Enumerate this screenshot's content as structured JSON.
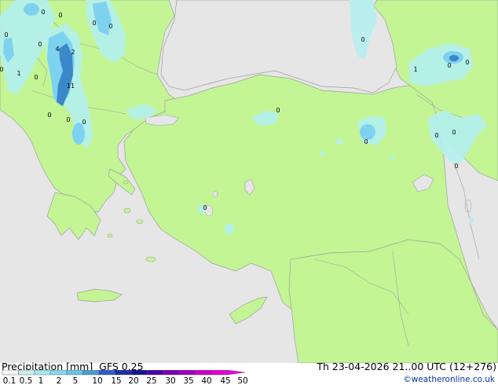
{
  "map": {
    "colors": {
      "sea": "#e6e6e6",
      "land": "#c3f595",
      "border": "#9e9e9e",
      "precip_light": "#b4f0f0",
      "precip_mid": "#7dd2f0",
      "precip_heavy": "#3c87c8"
    },
    "values": [
      "0",
      "0",
      "0",
      "0",
      "0",
      "4",
      "2",
      "0",
      "1",
      "0",
      "11",
      "0",
      "0",
      "0",
      "0",
      "0",
      "0",
      "1",
      "0",
      "0",
      "0",
      "0",
      "0",
      "0",
      "0"
    ]
  },
  "header": {
    "left_text": "Precipitation [mm]  GFS 0.25",
    "right_text": "Th 23-04-2026 21..00 UTC (12+276)"
  },
  "legend": {
    "labels": [
      "0.1",
      "0.5",
      "1",
      "2",
      "5",
      "10",
      "15",
      "20",
      "25",
      "30",
      "35",
      "40",
      "45",
      "50"
    ],
    "colors": [
      "#f5f5f5",
      "#c8f0f0",
      "#a5e6f0",
      "#87d7f0",
      "#64c3e6",
      "#4b9bd2",
      "#325ac8",
      "#1e2da0",
      "#14148c",
      "#4b00aa",
      "#7800b4",
      "#a000be",
      "#c800c8",
      "#e100d2",
      "#f000dc"
    ]
  },
  "credit": "©weatheronline.co.uk"
}
